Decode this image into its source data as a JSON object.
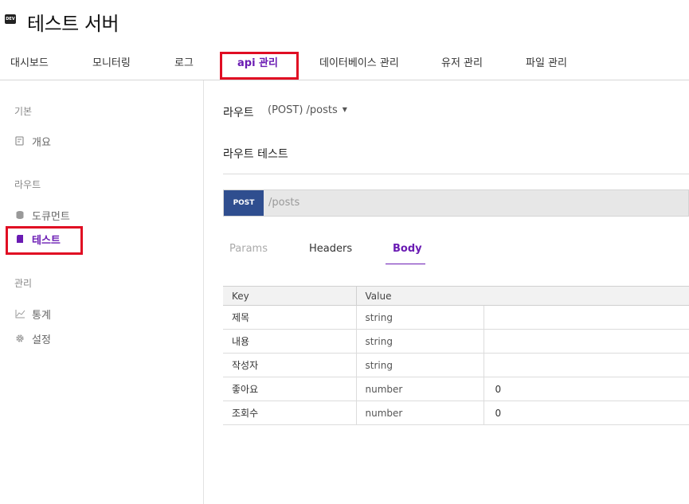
{
  "app": {
    "logo_text": "DEV",
    "title": "테스트 서버"
  },
  "tabs": [
    {
      "label": "대시보드"
    },
    {
      "label": "모니터링"
    },
    {
      "label": "로그"
    },
    {
      "label": "api 관리",
      "active": true
    },
    {
      "label": "데이터베이스 관리"
    },
    {
      "label": "유저 관리"
    },
    {
      "label": "파일 관리"
    }
  ],
  "sidebar": {
    "sections": [
      {
        "title": "기본",
        "items": [
          {
            "label": "개요",
            "icon": "overview-icon"
          }
        ]
      },
      {
        "title": "라우트",
        "items": [
          {
            "label": "도큐먼트",
            "icon": "database-icon"
          },
          {
            "label": "테스트",
            "icon": "test-icon",
            "active": true
          }
        ]
      },
      {
        "title": "관리",
        "items": [
          {
            "label": "통계",
            "icon": "chart-icon"
          },
          {
            "label": "설정",
            "icon": "gear-icon"
          }
        ]
      }
    ]
  },
  "main": {
    "route_label": "라우트",
    "route_select": "(POST) /posts",
    "route_test_title": "라우트 테스트",
    "request": {
      "method": "POST",
      "url": "/posts"
    },
    "subtabs": [
      {
        "label": "Params",
        "state": "disabled"
      },
      {
        "label": "Headers",
        "state": "normal"
      },
      {
        "label": "Body",
        "state": "active"
      }
    ],
    "table": {
      "headers": [
        "Key",
        "Value"
      ],
      "rows": [
        {
          "key": "제목",
          "type": "string",
          "value": ""
        },
        {
          "key": "내용",
          "type": "string",
          "value": ""
        },
        {
          "key": "작성자",
          "type": "string",
          "value": ""
        },
        {
          "key": "좋아요",
          "type": "number",
          "value": "0"
        },
        {
          "key": "조회수",
          "type": "number",
          "value": "0"
        }
      ]
    }
  },
  "colors": {
    "accent": "#6a1bb3",
    "method_badge": "#2f4e8f",
    "highlight_outline": "#e00d23"
  }
}
